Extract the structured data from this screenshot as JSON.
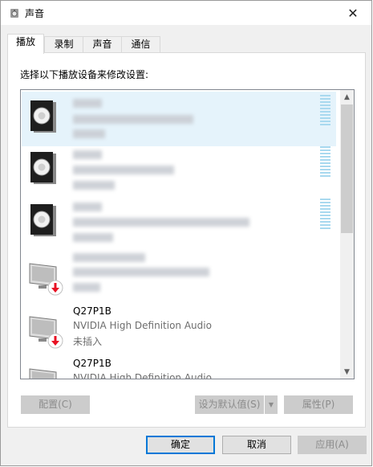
{
  "window": {
    "title": "声音",
    "close_glyph": "✕"
  },
  "tabs": [
    {
      "label": "播放"
    },
    {
      "label": "录制"
    },
    {
      "label": "声音"
    },
    {
      "label": "通信"
    }
  ],
  "instruction": "选择以下播放设备来修改设置:",
  "devices": [
    {
      "type": "speaker",
      "name": "",
      "line2": "",
      "line3": "",
      "selected": true
    },
    {
      "type": "speaker",
      "name": "",
      "line2": "",
      "line3": "",
      "selected": false
    },
    {
      "type": "speaker",
      "name": "",
      "line2": "",
      "line3": "",
      "selected": false
    },
    {
      "type": "monitor",
      "name": "",
      "line2": "",
      "line3": "",
      "selected": false
    },
    {
      "type": "monitor",
      "name": "Q27P1B",
      "line2": "NVIDIA High Definition Audio",
      "line3": "未插入",
      "selected": false
    },
    {
      "type": "monitor",
      "name": "Q27P1B",
      "line2": "NVIDIA High Definition Audio",
      "line3": "",
      "selected": false
    }
  ],
  "buttons": {
    "configure": "配置(C)",
    "set_default": "设为默认值(S)",
    "properties": "属性(P)",
    "ok": "确定",
    "cancel": "取消",
    "apply": "应用(A)"
  },
  "icons": {
    "app": "speaker-icon",
    "close": "close-icon",
    "scroll_up": "▲",
    "scroll_down": "▼",
    "dropdown": "▼"
  },
  "colors": {
    "accent": "#0078d7",
    "selection": "#e5f3fb",
    "meter": "#a9d9ef",
    "disconnected": "#e81123"
  }
}
